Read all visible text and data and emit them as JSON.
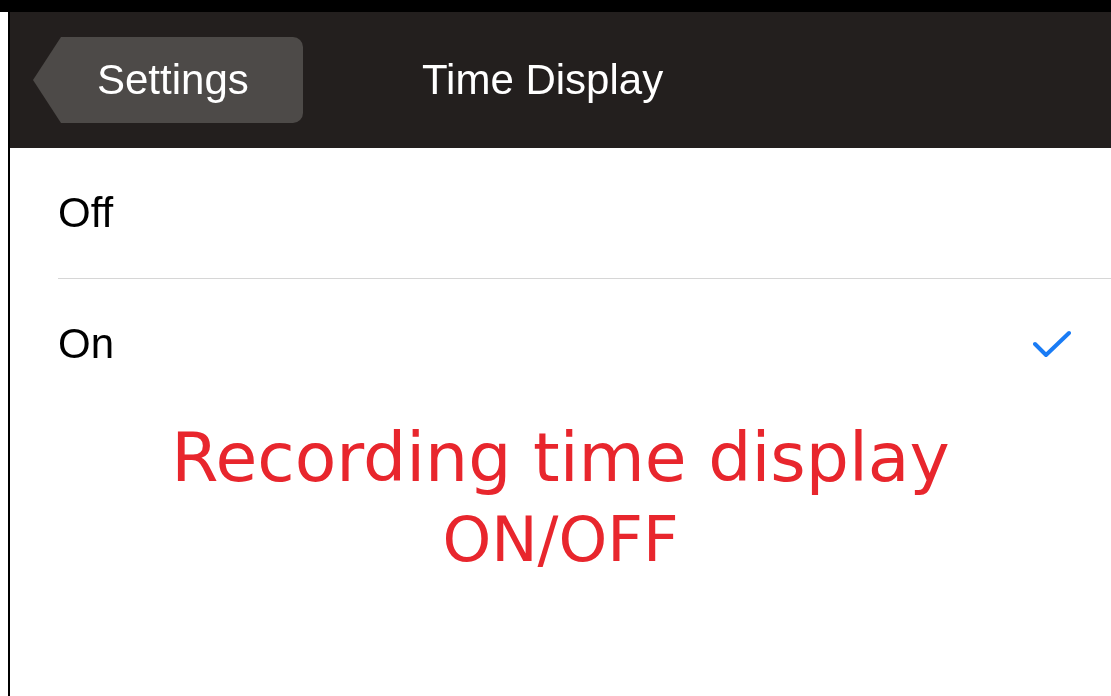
{
  "nav_bar": {
    "back_button": "Settings",
    "title": "Time Display"
  },
  "options": [
    {
      "label": "Off",
      "selected": false
    },
    {
      "label": "On",
      "selected": true
    }
  ],
  "annotation": {
    "lines": [
      "Recording time display",
      "ON/OFF"
    ]
  }
}
